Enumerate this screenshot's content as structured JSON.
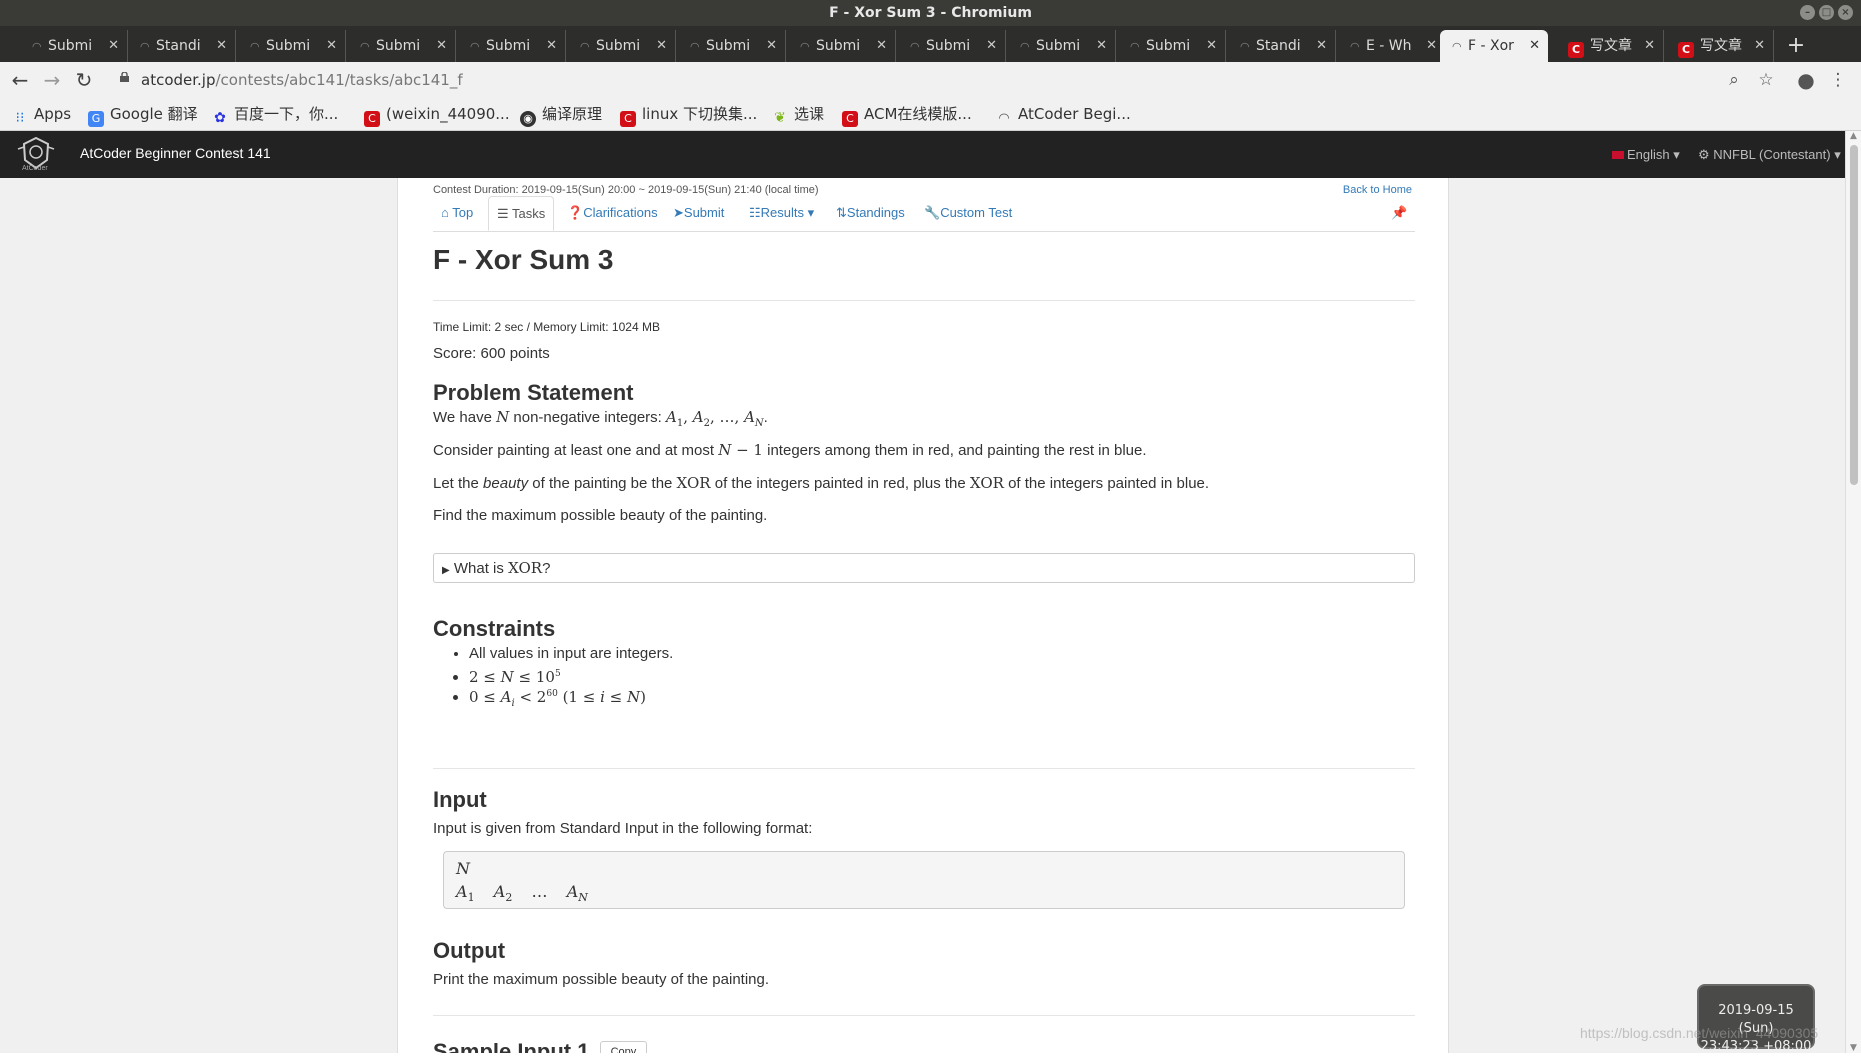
{
  "window": {
    "title": "F - Xor Sum 3 - Chromium"
  },
  "tabs": [
    {
      "label": "Submi"
    },
    {
      "label": "Standi"
    },
    {
      "label": "Submi"
    },
    {
      "label": "Submi"
    },
    {
      "label": "Submi"
    },
    {
      "label": "Submi"
    },
    {
      "label": "Submi"
    },
    {
      "label": "Submi"
    },
    {
      "label": "Submi"
    },
    {
      "label": "Submi"
    },
    {
      "label": "Submi"
    },
    {
      "label": "Standi"
    },
    {
      "label": "E - Wh"
    },
    {
      "label": "F - Xor"
    },
    {
      "label": "写文章"
    },
    {
      "label": "写文章"
    }
  ],
  "toolbar": {
    "url_host": "atcoder.jp",
    "url_path": "/contests/abc141/tasks/abc141_f"
  },
  "bookmarks": [
    {
      "label": "Apps"
    },
    {
      "label": "Google 翻译"
    },
    {
      "label": "百度一下，你..."
    },
    {
      "label": "(weixin_44090..."
    },
    {
      "label": "编译原理"
    },
    {
      "label": "linux 下切换集..."
    },
    {
      "label": "选课"
    },
    {
      "label": "ACM在线模版..."
    },
    {
      "label": "AtCoder Begi..."
    }
  ],
  "atcoder": {
    "brand": "AtCoder Beginner Contest 141",
    "logo_text": "AtCoder",
    "language": "English",
    "user": "NNFBL (Contestant)"
  },
  "contest": {
    "duration_prefix": "Contest Duration: ",
    "duration_start": "2019-09-15(Sun) 20:00",
    "duration_sep": " ~ ",
    "duration_end": "2019-09-15(Sun) 21:40",
    "duration_suffix": " (local time)",
    "back_home": "Back to Home"
  },
  "nav": {
    "top": "Top",
    "tasks": "Tasks",
    "clarifications": "Clarifications",
    "submit": "Submit",
    "results": "Results",
    "standings": "Standings",
    "custom_test": "Custom Test"
  },
  "task": {
    "title": "F - Xor Sum 3",
    "limits": "Time Limit: 2 sec / Memory Limit: 1024 MB",
    "score": "Score: 600 points",
    "h_statement": "Problem Statement",
    "s1_a": "We have ",
    "s1_b": " non-negative integers: ",
    "s2_a": "Consider painting at least one and at most ",
    "s2_b": " integers among them in red, and painting the rest in blue.",
    "s3_a": "Let the ",
    "s3_em": "beauty",
    "s3_b": " of the painting be the ",
    "s3_c": " of the integers painted in red, plus the ",
    "s3_d": " of the integers painted in blue.",
    "s4": "Find the maximum possible beauty of the painting.",
    "xor_word": "XOR",
    "details_a": "What is ",
    "details_b": "?",
    "h_constraints": "Constraints",
    "c1": "All values in input are integers.",
    "h_input": "Input",
    "input_text": "Input is given from Standard Input in the following format:",
    "h_output": "Output",
    "output_text": "Print the maximum possible beauty of the painting.",
    "h_sample": "Sample Input 1",
    "copy": "Copy"
  },
  "clock": {
    "date": "2019-09-15 (Sun)",
    "time": "23:43:23 +08:00"
  },
  "watermark": "https://blog.csdn.net/weixin_44090305"
}
